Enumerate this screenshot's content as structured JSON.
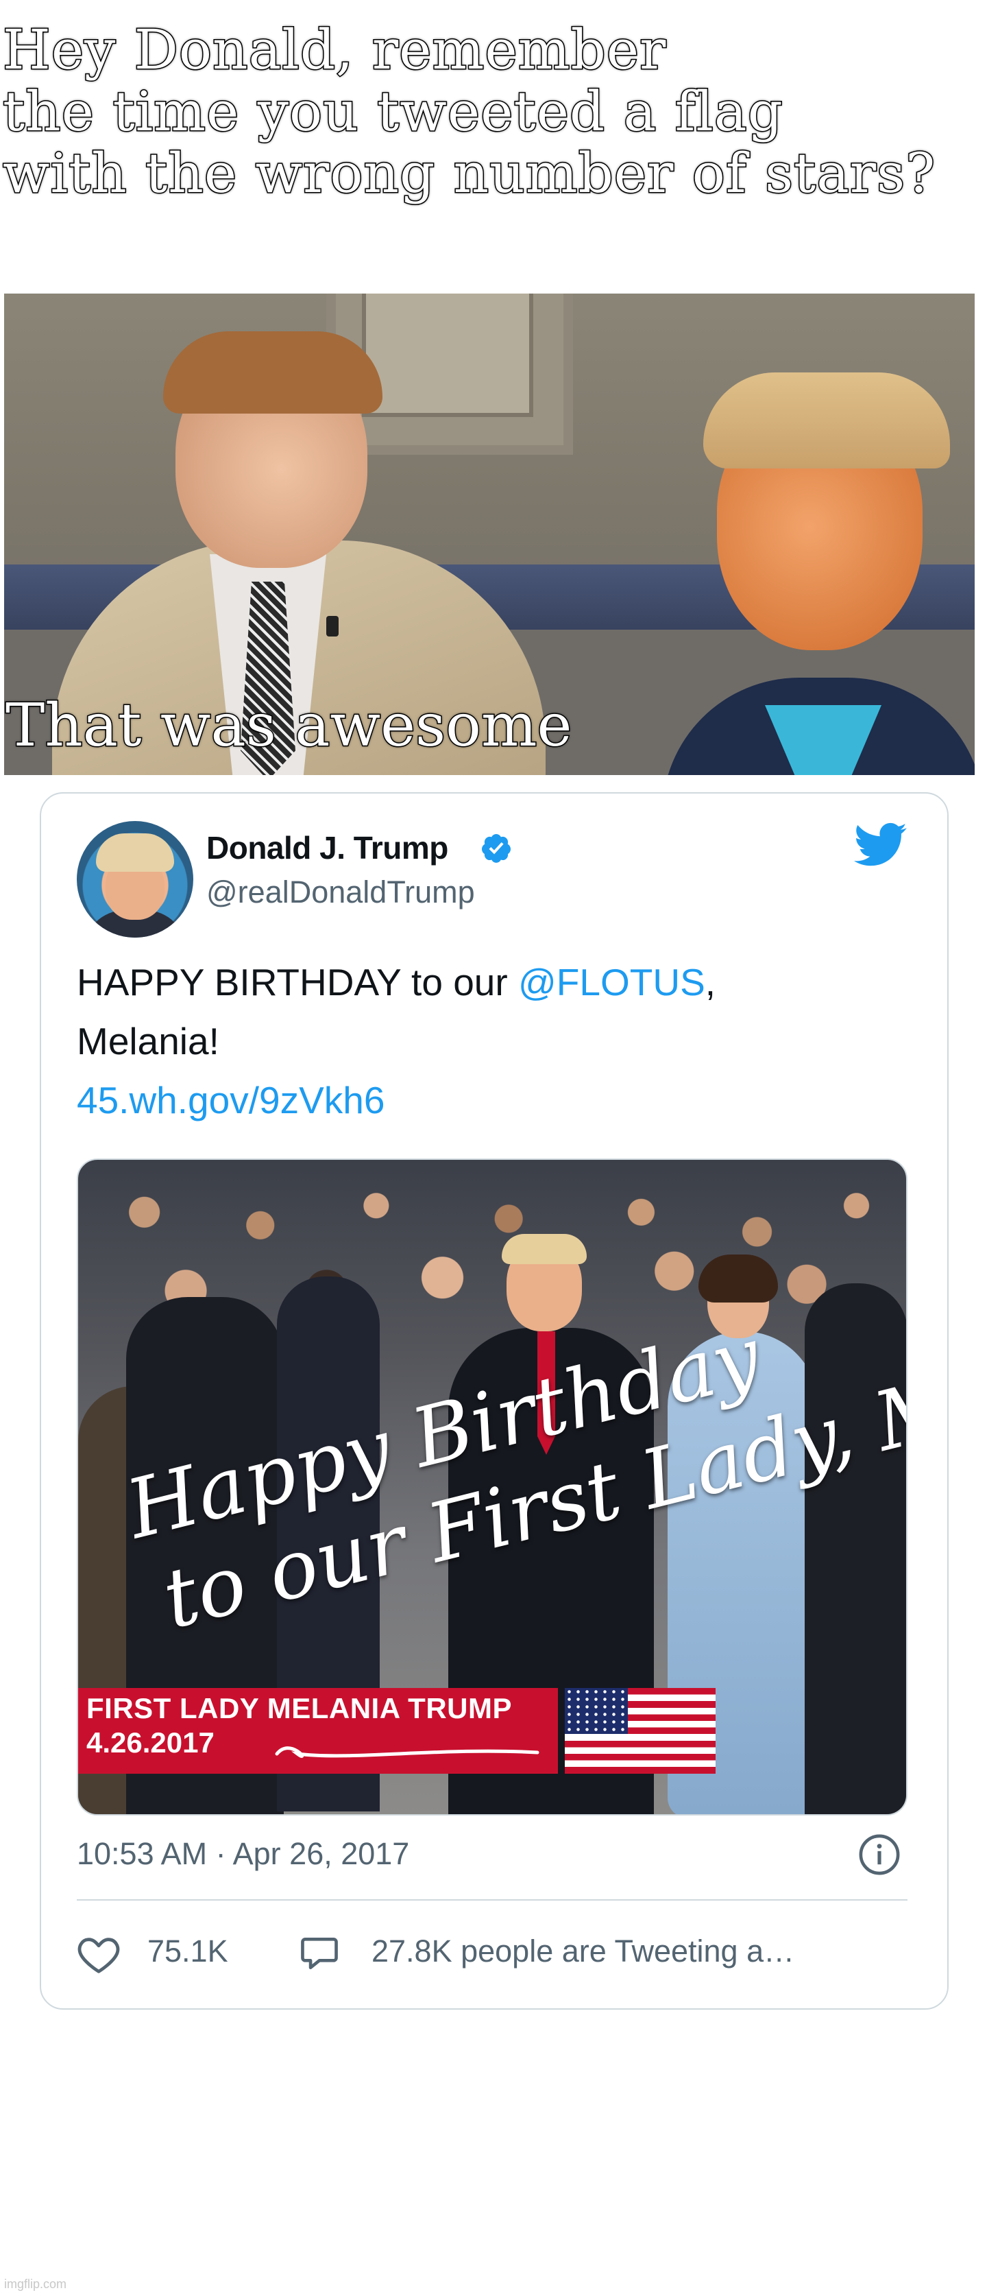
{
  "meme": {
    "top_caption": "Hey Donald, remember\nthe time you tweeted a flag\nwith the wrong number of stars?",
    "photo_caption": "That was awesome"
  },
  "tweet": {
    "display_name": "Donald J. Trump",
    "verified": true,
    "handle": "@realDonaldTrump",
    "text_before_mention": "HAPPY BIRTHDAY to our ",
    "mention": "@FLOTUS",
    "text_after_mention": ",",
    "text_line2": "Melania!",
    "link": "45.wh.gov/9zVkh6",
    "image": {
      "overlay_line1": "Happy Birthday",
      "overlay_line2": "to our First Lady, Melania!",
      "banner_title": "FIRST LADY MELANIA TRUMP",
      "banner_date": "4.26.2017"
    },
    "timestamp": "10:53 AM · Apr 26, 2017",
    "likes": "75.1K",
    "replies_text": "27.8K people are Tweeting a…"
  },
  "watermark": "imgflip.com",
  "colors": {
    "link": "#1d9bf0",
    "verified": "#1d9bf0",
    "twitter_brand": "#1d9bf0",
    "secondary_text": "#536471",
    "banner_red": "#c8102e"
  },
  "icons": [
    "verified-badge-icon",
    "twitter-bird-icon",
    "info-icon",
    "heart-icon",
    "comment-bubble-icon"
  ]
}
